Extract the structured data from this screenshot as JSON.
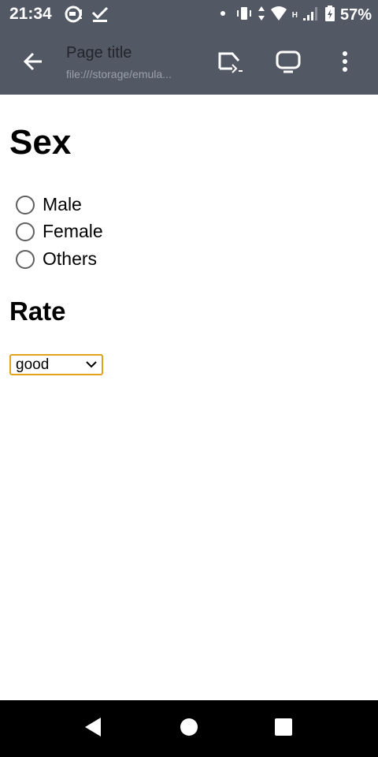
{
  "status_bar": {
    "time": "21:34",
    "battery": "57%",
    "network": "H",
    "icons": [
      "messenger-icon",
      "check-icon",
      "dot-icon",
      "vibrate-icon",
      "wifi-icon",
      "signal-icon",
      "battery-charging-icon"
    ]
  },
  "toolbar": {
    "title": "Page title",
    "url": "file:///storage/emula...",
    "icons": [
      "back-arrow-icon",
      "cast-icon",
      "screen-icon",
      "more-vert-icon"
    ]
  },
  "form": {
    "sex_heading": "Sex",
    "options": [
      {
        "label": "Male",
        "checked": false
      },
      {
        "label": "Female",
        "checked": false
      },
      {
        "label": "Others",
        "checked": false
      }
    ],
    "rate_heading": "Rate",
    "rate_value": "good"
  },
  "nav_bar": {
    "icons": [
      "back-triangle-icon",
      "home-circle-icon",
      "recents-square-icon"
    ]
  },
  "colors": {
    "bar_bg": "#535865",
    "select_border": "#e3a21a",
    "nav_bg": "#000000"
  }
}
